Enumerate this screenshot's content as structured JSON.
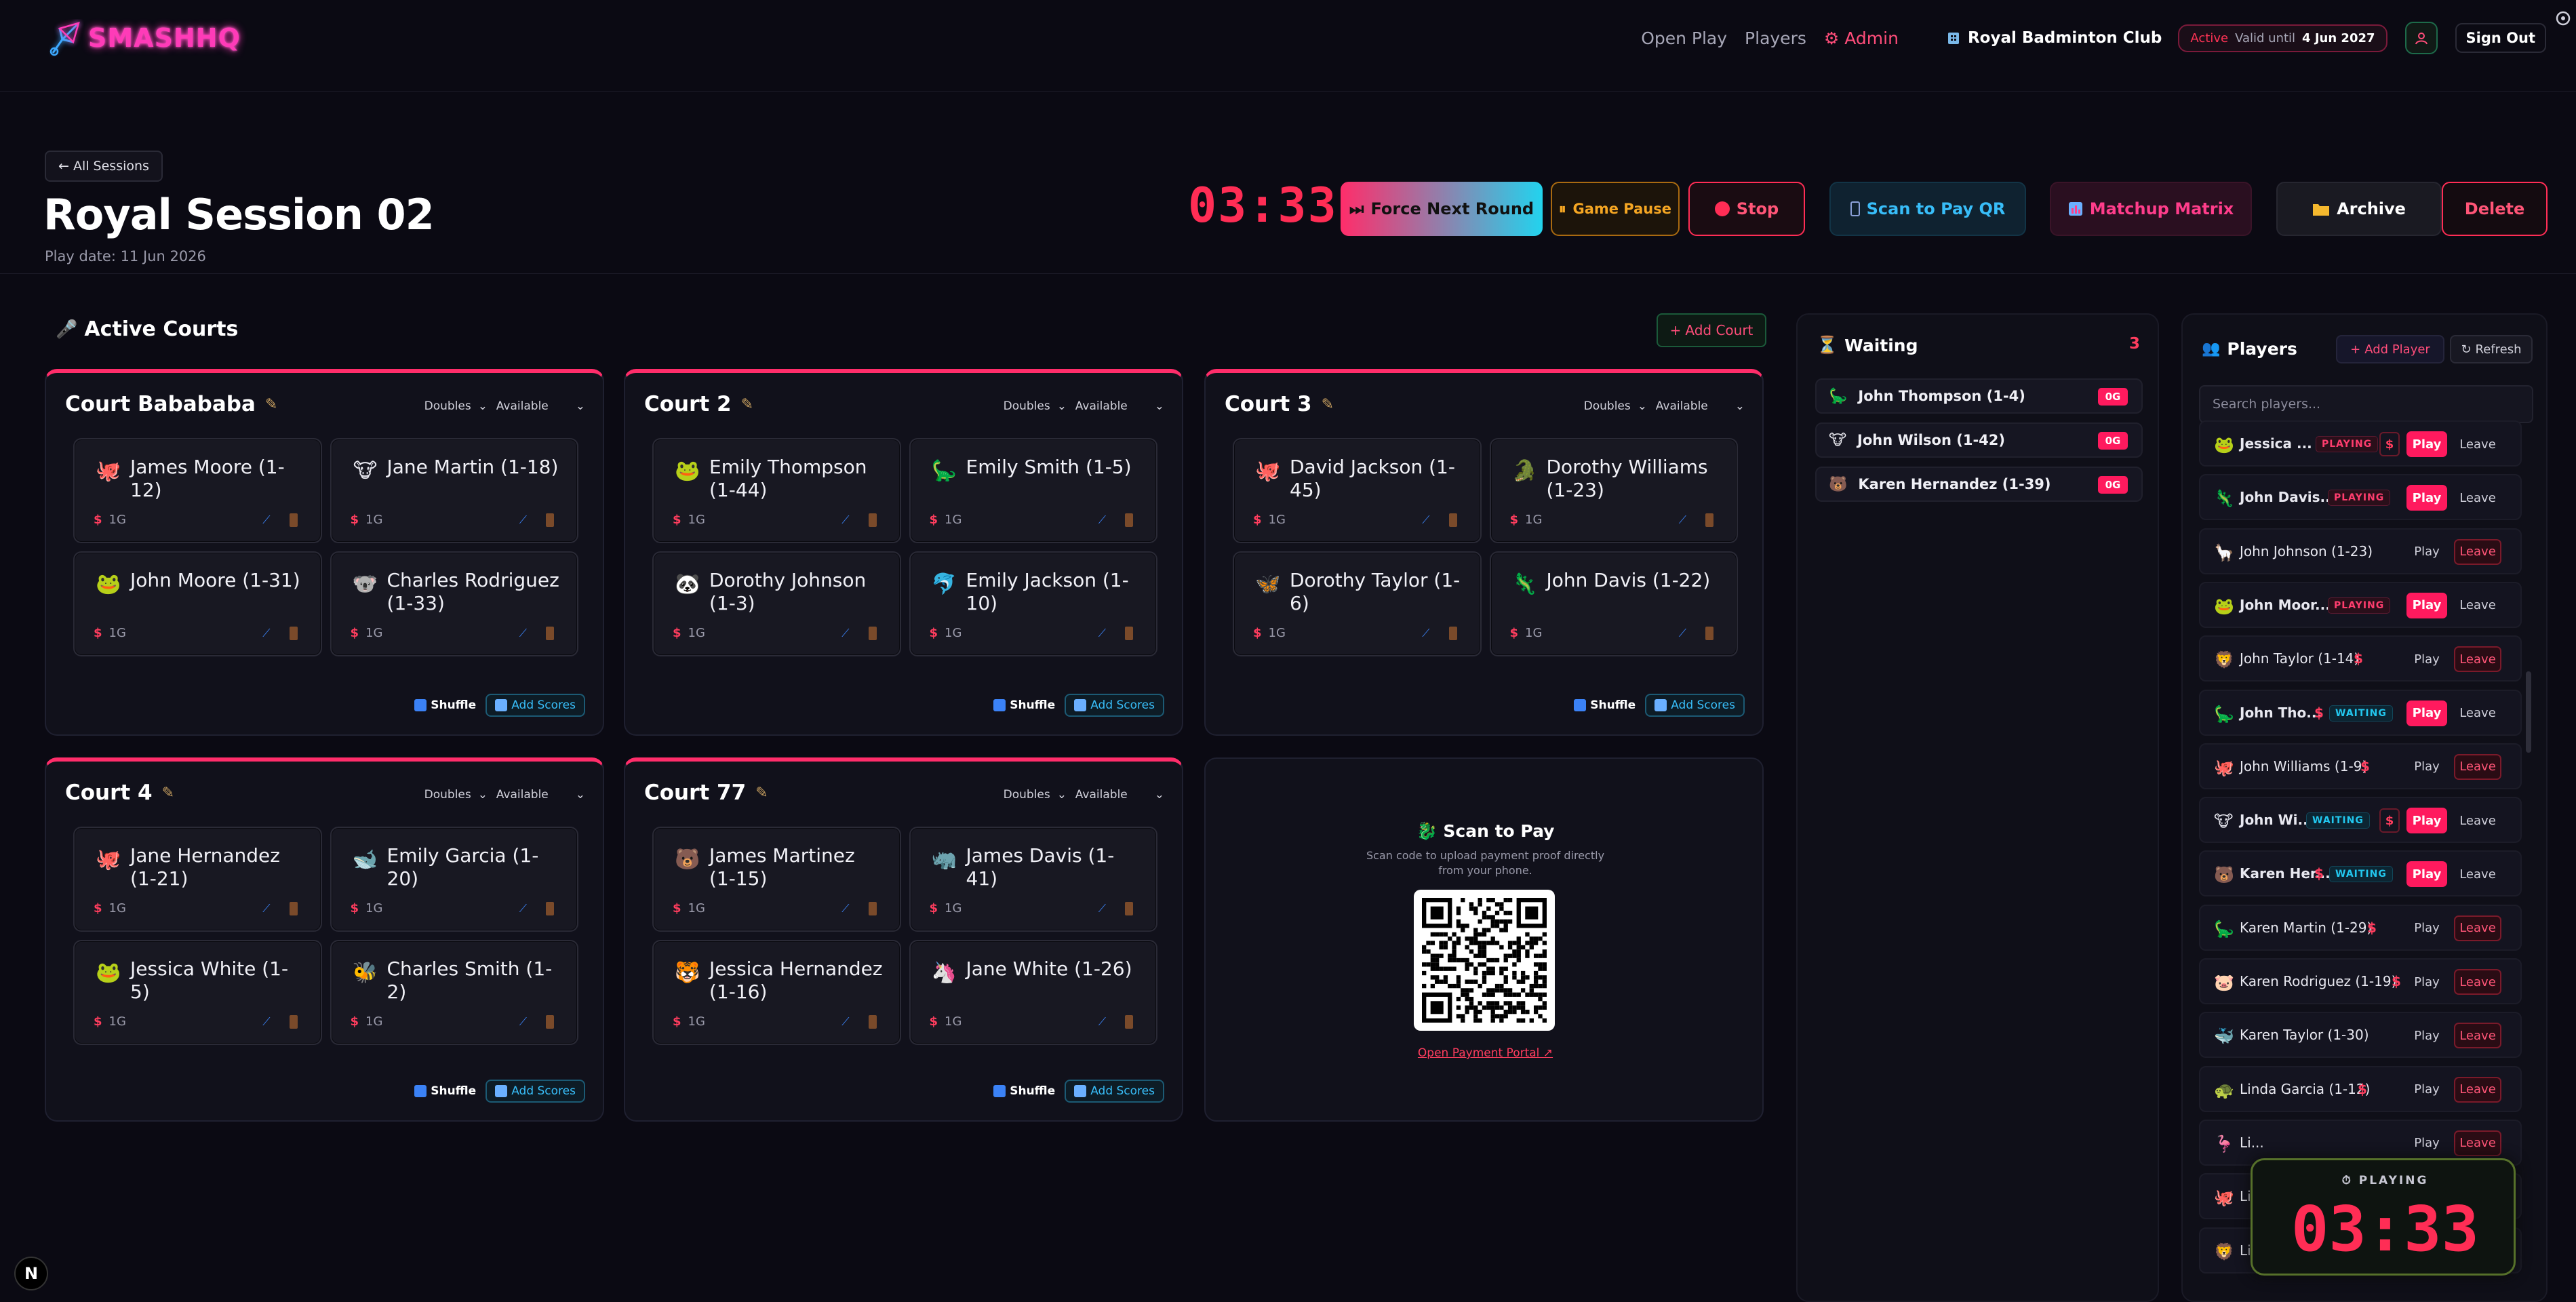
{
  "app": {
    "logo": "SMASHHQ"
  },
  "nav": {
    "open_play": "Open Play",
    "players": "Players",
    "admin": "Admin",
    "club": "Royal Badminton Club",
    "status_active": "Active",
    "status_valid": "Valid until",
    "status_date": "4 Jun 2027",
    "sign_out": "Sign Out"
  },
  "session": {
    "back": "← All Sessions",
    "title": "Royal Session 02",
    "play_date": "Play date: 11 Jun 2026",
    "timer": "03:33"
  },
  "actions": {
    "force_next": "Force Next Round",
    "game_pause": "Game Pause",
    "stop": "Stop",
    "scan_qr": "Scan to Pay QR",
    "matrix": "Matchup Matrix",
    "archive": "Archive",
    "delete": "Delete"
  },
  "courts_section": {
    "title": "Active Courts",
    "add_court": "Add Court"
  },
  "court_labels": {
    "shuffle": "Shuffle",
    "add_scores": "Add Scores",
    "payment": "1G",
    "currency": "$"
  },
  "courts": [
    {
      "name": "Court Babababa",
      "type": "Doubles",
      "status": "Available",
      "players": [
        {
          "icon": "🐙",
          "name": "James Moore (1-12)"
        },
        {
          "icon": "🐮",
          "name": "Jane Martin (1-18)"
        },
        {
          "icon": "🐸",
          "name": "John Moore (1-31)"
        },
        {
          "icon": "🐨",
          "name": "Charles Rodriguez (1-33)"
        }
      ]
    },
    {
      "name": "Court 2",
      "type": "Doubles",
      "status": "Available",
      "players": [
        {
          "icon": "🐸",
          "name": "Emily Thompson (1-44)"
        },
        {
          "icon": "🦕",
          "name": "Emily Smith (1-5)"
        },
        {
          "icon": "🐼",
          "name": "Dorothy Johnson (1-3)"
        },
        {
          "icon": "🐬",
          "name": "Emily Jackson (1-10)"
        }
      ]
    },
    {
      "name": "Court 3",
      "type": "Doubles",
      "status": "Available",
      "players": [
        {
          "icon": "🐙",
          "name": "David Jackson (1-45)"
        },
        {
          "icon": "🐊",
          "name": "Dorothy Williams (1-23)"
        },
        {
          "icon": "🦋",
          "name": "Dorothy Taylor (1-6)"
        },
        {
          "icon": "🦎",
          "name": "John Davis (1-22)"
        }
      ]
    },
    {
      "name": "Court 4",
      "type": "Doubles",
      "status": "Available",
      "players": [
        {
          "icon": "🐙",
          "name": "Jane Hernandez (1-21)"
        },
        {
          "icon": "🐋",
          "name": "Emily Garcia (1-20)"
        },
        {
          "icon": "🐸",
          "name": "Jessica White (1-5)"
        },
        {
          "icon": "🐝",
          "name": "Charles Smith (1-2)"
        }
      ]
    },
    {
      "name": "Court 77",
      "type": "Doubles",
      "status": "Available",
      "players": [
        {
          "icon": "🐻",
          "name": "James Martinez (1-15)"
        },
        {
          "icon": "🦏",
          "name": "James Davis (1-41)"
        },
        {
          "icon": "🐯",
          "name": "Jessica Hernandez (1-16)"
        },
        {
          "icon": "🦄",
          "name": "Jane White (1-26)"
        }
      ]
    }
  ],
  "scan_card": {
    "title": "Scan to Pay",
    "desc": "Scan code to upload payment proof directly from your phone.",
    "link": "Open Payment Portal ↗"
  },
  "waiting": {
    "title": "Waiting",
    "count": "3",
    "items": [
      {
        "icon": "🦕",
        "name": "John Thompson (1-4)",
        "badge": "0G"
      },
      {
        "icon": "🐮",
        "name": "John Wilson (1-42)",
        "badge": "0G"
      },
      {
        "icon": "🐻",
        "name": "Karen Hernandez (1-39)",
        "badge": "0G"
      }
    ]
  },
  "players_panel": {
    "title": "Players",
    "add": "Add Player",
    "refresh": "Refresh",
    "search_placeholder": "Search players...",
    "play_label": "Play",
    "leave_label": "Leave",
    "rows": [
      {
        "icon": "🐸",
        "name": "Jessica ...",
        "status": "PLAYING"
      },
      {
        "icon": "🦎",
        "name": "John Davis...",
        "status": "PLAYING"
      },
      {
        "icon": "🦙",
        "name": "John Johnson (1-23)",
        "status": ""
      },
      {
        "icon": "🐸",
        "name": "John Moor...",
        "status": "PLAYING"
      },
      {
        "icon": "🦁",
        "name": "John Taylor (1-14)",
        "status": ""
      },
      {
        "icon": "🦕",
        "name": "John Tho...",
        "status": "WAITING"
      },
      {
        "icon": "🐙",
        "name": "John Williams (1-9)",
        "status": ""
      },
      {
        "icon": "🐮",
        "name": "John Wi...",
        "status": "WAITING"
      },
      {
        "icon": "🐻",
        "name": "Karen Her...",
        "status": "WAITING"
      },
      {
        "icon": "🦕",
        "name": "Karen Martin (1-29)",
        "status": ""
      },
      {
        "icon": "🐷",
        "name": "Karen Rodriguez (1-19)",
        "status": ""
      },
      {
        "icon": "🐳",
        "name": "Karen Taylor (1-30)",
        "status": ""
      },
      {
        "icon": "🐢",
        "name": "Linda Garcia (1-12)",
        "status": ""
      },
      {
        "icon": "🦩",
        "name": "Li...",
        "status": ""
      },
      {
        "icon": "🐙",
        "name": "Li...",
        "status": ""
      },
      {
        "icon": "🦁",
        "name": "Linda Wilson (1-26)",
        "status": ""
      }
    ]
  },
  "floating_timer": {
    "label": "PLAYING",
    "time": "03:33"
  },
  "colors": {
    "accent": "#ff2d6a",
    "cyan": "#22d3ee",
    "bg": "#0b0a13"
  }
}
